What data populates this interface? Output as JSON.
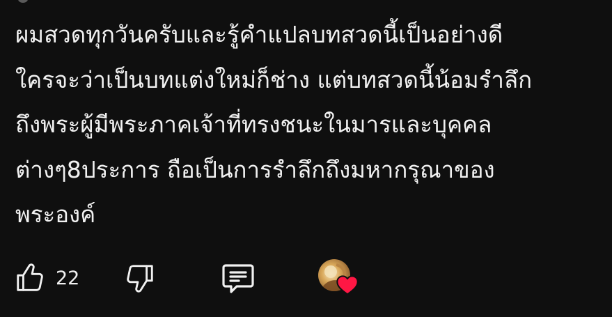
{
  "comment": {
    "lines": [
      "ผมสวดทุกวันครับและรู้คำแปลบทสวดนี้เป็นอย่างดี",
      "ใครจะว่าเป็นบทแต่งใหม่ก็ช่าง แต่บทสวดนี้น้อมรำลึก",
      "ถึงพระผู้มีพระภาคเจ้าที่ทรงชนะในมารและบุคคล",
      "ต่างๆ8ประการ ถือเป็นการรำลึกถึงมหากรุณาของ",
      "พระองค์"
    ]
  },
  "actions": {
    "like_icon": "thumb-up-outline-icon",
    "like_count": "22",
    "dislike_icon": "thumb-down-outline-icon",
    "reply_icon": "comment-reply-icon",
    "creator_heart_icon": "heart-icon"
  },
  "colors": {
    "background": "#0f0f0f",
    "text": "#f1f1f1",
    "heart": "#ff1744"
  }
}
